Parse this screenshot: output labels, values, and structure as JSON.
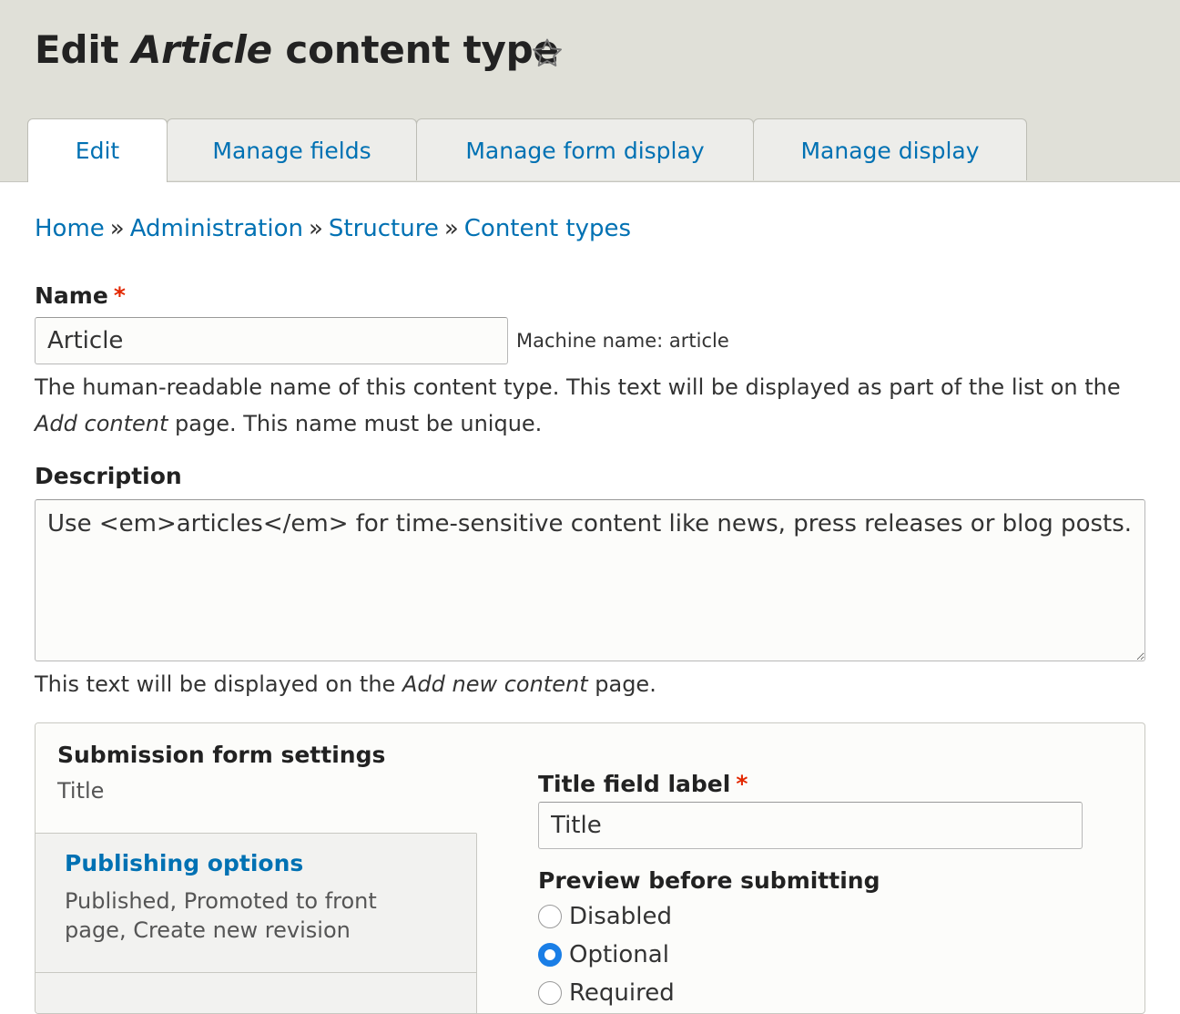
{
  "header": {
    "title_prefix": "Edit",
    "title_emphasis": "Article",
    "title_suffix": "content type",
    "shortcut_icon": "star-outline-icon"
  },
  "tabs": [
    {
      "label": "Edit",
      "active": true
    },
    {
      "label": "Manage fields",
      "active": false
    },
    {
      "label": "Manage form display",
      "active": false
    },
    {
      "label": "Manage display",
      "active": false
    }
  ],
  "breadcrumb": {
    "items": [
      "Home",
      "Administration",
      "Structure",
      "Content types"
    ],
    "separator": "»"
  },
  "name_field": {
    "label": "Name",
    "required_marker": "*",
    "value": "Article",
    "machine_name": "Machine name: article",
    "help_part1": "The human-readable name of this content type. This text will be displayed as part of the list on the",
    "help_emphasis": "Add content",
    "help_part2": "page. This name must be unique."
  },
  "description_field": {
    "label": "Description",
    "value": "Use <em>articles</em> for time-sensitive content like news, press releases or blog posts.",
    "help_part1": "This text will be displayed on the",
    "help_emphasis": "Add new content",
    "help_part2": "page."
  },
  "vertical_tabs": {
    "items": [
      {
        "title": "Submission form settings",
        "summary": "Title",
        "selected": true
      },
      {
        "title": "Publishing options",
        "summary": "Published, Promoted to front page, Create new revision",
        "selected": false
      }
    ]
  },
  "submission_settings": {
    "title_label": "Title field label",
    "required_marker": "*",
    "title_value": "Title",
    "preview_label": "Preview before submitting",
    "preview_options": [
      "Disabled",
      "Optional",
      "Required"
    ],
    "preview_selected": "Optional"
  },
  "colors": {
    "link": "#0071b3",
    "required": "#e32700",
    "header_bg": "#e0e0d8",
    "radio_checked": "#1a7ee6"
  }
}
